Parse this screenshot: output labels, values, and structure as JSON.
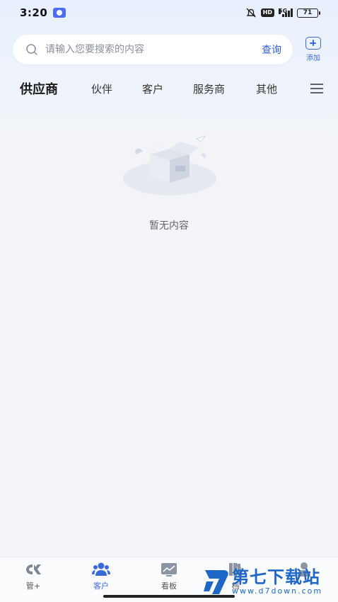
{
  "status_bar": {
    "time": "3:20",
    "network": "5G",
    "hd": "HD",
    "battery": "71"
  },
  "search": {
    "placeholder": "请输入您要搜索的内容",
    "query_label": "查询",
    "add_label": "添加"
  },
  "tabs": [
    {
      "label": "供应商",
      "active": true
    },
    {
      "label": "伙伴"
    },
    {
      "label": "客户"
    },
    {
      "label": "服务商"
    },
    {
      "label": "其他"
    }
  ],
  "empty": {
    "text": "暂无内容"
  },
  "bottom_nav": [
    {
      "label": "管+",
      "icon": "logo-icon"
    },
    {
      "label": "客户",
      "icon": "users-icon",
      "active": true
    },
    {
      "label": "看板",
      "icon": "chart-board-icon"
    },
    {
      "label": "档",
      "icon": "books-icon"
    },
    {
      "label": "",
      "icon": "person-icon"
    }
  ],
  "watermark": {
    "title": "第七下载站",
    "url": "www.d7down.com"
  },
  "colors": {
    "accent": "#3a6ad9",
    "background": "#f2f4f8"
  }
}
